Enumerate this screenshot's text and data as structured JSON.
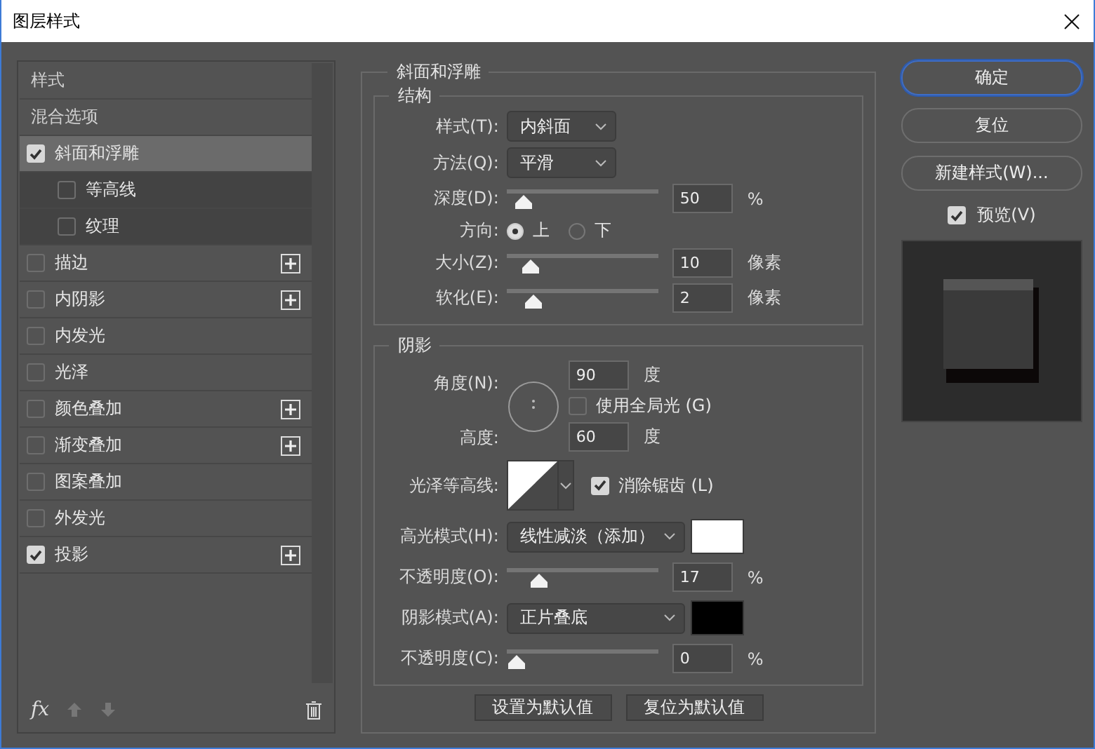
{
  "window": {
    "title": "图层样式"
  },
  "styles_list": {
    "items": [
      {
        "kind": "header",
        "label": "样式",
        "selected": false
      },
      {
        "kind": "header",
        "label": "混合选项",
        "selected": false
      },
      {
        "kind": "effect",
        "label": "斜面和浮雕",
        "checked": true,
        "selected": true,
        "add_button": false,
        "children": [
          {
            "label": "等高线",
            "checked": false,
            "selected": false
          },
          {
            "label": "纹理",
            "checked": false,
            "selected": false
          }
        ]
      },
      {
        "kind": "effect",
        "label": "描边",
        "checked": false,
        "selected": false,
        "add_button": true
      },
      {
        "kind": "effect",
        "label": "内阴影",
        "checked": false,
        "selected": false,
        "add_button": true
      },
      {
        "kind": "effect",
        "label": "内发光",
        "checked": false,
        "selected": false,
        "add_button": false
      },
      {
        "kind": "effect",
        "label": "光泽",
        "checked": false,
        "selected": false,
        "add_button": false
      },
      {
        "kind": "effect",
        "label": "颜色叠加",
        "checked": false,
        "selected": false,
        "add_button": true
      },
      {
        "kind": "effect",
        "label": "渐变叠加",
        "checked": false,
        "selected": false,
        "add_button": true
      },
      {
        "kind": "effect",
        "label": "图案叠加",
        "checked": false,
        "selected": false,
        "add_button": false
      },
      {
        "kind": "effect",
        "label": "外发光",
        "checked": false,
        "selected": false,
        "add_button": false
      },
      {
        "kind": "effect",
        "label": "投影",
        "checked": true,
        "selected": false,
        "add_button": true
      }
    ],
    "footer": {
      "fx": "fx"
    }
  },
  "bevel_emboss": {
    "title": "斜面和浮雕",
    "structure": {
      "title": "结构",
      "style": {
        "label": "样式(T):",
        "value": "内斜面"
      },
      "technique": {
        "label": "方法(Q):",
        "value": "平滑"
      },
      "depth": {
        "label": "深度(D):",
        "level": 0.05,
        "value": "50",
        "unit": "%"
      },
      "direction": {
        "label": "方向:",
        "options": [
          {
            "label": "上",
            "selected": true
          },
          {
            "label": "下",
            "selected": false
          }
        ]
      },
      "size": {
        "label": "大小(Z):",
        "level": 0.1,
        "value": "10",
        "unit": "像素"
      },
      "soften": {
        "label": "软化(E):",
        "level": 0.12,
        "value": "2",
        "unit": "像素"
      }
    },
    "shading": {
      "title": "阴影",
      "angle": {
        "label": "角度(N):",
        "value": "90",
        "unit": "度"
      },
      "use_global_light": {
        "label": "使用全局光 (G)",
        "checked": false
      },
      "altitude": {
        "label": "高度:",
        "value": "60",
        "unit": "度"
      },
      "gloss_contour": {
        "label": "光泽等高线:"
      },
      "anti_aliased": {
        "label": "消除锯齿 (L)",
        "checked": true
      },
      "highlight_mode": {
        "label": "高光模式(H):",
        "value": "线性减淡（添加）",
        "color": "#ffffff"
      },
      "highlight_opacity": {
        "label": "不透明度(O):",
        "level": 0.17,
        "value": "17",
        "unit": "%"
      },
      "shadow_mode": {
        "label": "阴影模式(A):",
        "value": "正片叠底",
        "color": "#000000"
      },
      "shadow_opacity": {
        "label": "不透明度(C):",
        "level": 0,
        "value": "0",
        "unit": "%"
      }
    },
    "buttons": [
      "设置为默认值",
      "复位为默认值"
    ]
  },
  "actions": {
    "buttons": [
      {
        "label": "确定",
        "primary": true
      },
      {
        "label": "复位",
        "primary": false
      },
      {
        "label": "新建样式(W)...",
        "primary": false
      }
    ],
    "preview": {
      "label": "预览(V)",
      "checked": true
    }
  }
}
